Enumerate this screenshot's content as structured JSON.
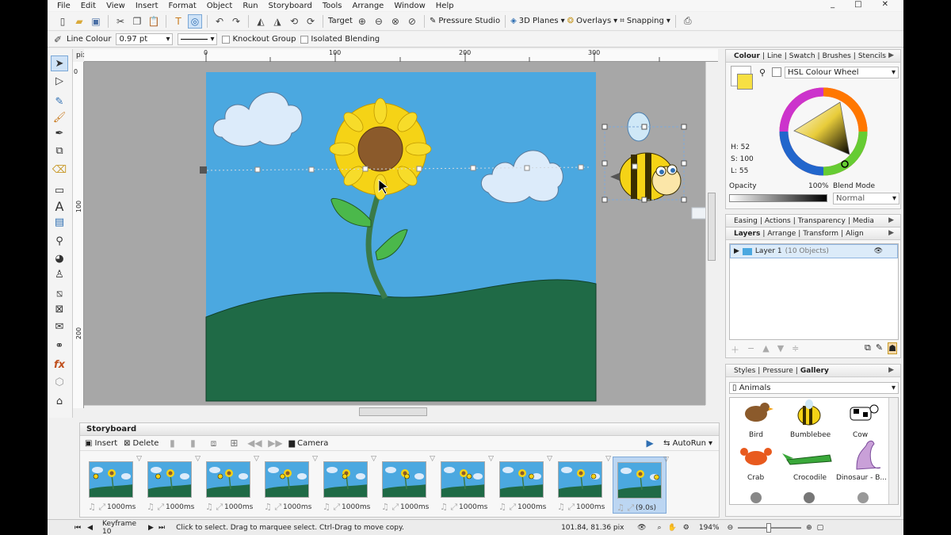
{
  "menu": [
    "File",
    "Edit",
    "View",
    "Insert",
    "Format",
    "Object",
    "Run",
    "Storyboard",
    "Tools",
    "Arrange",
    "Window",
    "Help"
  ],
  "window_controls": {
    "minimize": "_",
    "restore": "□",
    "close": "✕"
  },
  "toolbar": {
    "target": "Target",
    "pressure_studio": "Pressure Studio",
    "planes_3d": "3D Planes",
    "overlays": "Overlays",
    "snapping": "Snapping"
  },
  "context": {
    "line_colour_label": "Line Colour",
    "line_width": "0.97 pt",
    "knockout_group": "Knockout Group",
    "isolated_blending": "Isolated Blending"
  },
  "ruler": {
    "unit": "pix",
    "h_ticks": [
      "0",
      "100",
      "200",
      "300"
    ],
    "v_ticks": [
      "0",
      "100",
      "200"
    ]
  },
  "colour_panel": {
    "tabs": [
      "Colour",
      "Line",
      "Swatch",
      "Brushes",
      "Stencils"
    ],
    "model": "HSL Colour Wheel",
    "h": "H: 52",
    "s": "S: 100",
    "l": "L: 55",
    "opacity_label": "Opacity",
    "opacity_value": "100%",
    "blend_mode_label": "Blend Mode",
    "blend_mode": "Normal",
    "fill_color": "#f7e043"
  },
  "panel_tabs_2": [
    "Easing",
    "Actions",
    "Transparency",
    "Media"
  ],
  "layers_panel": {
    "tabs": [
      "Layers",
      "Arrange",
      "Transform",
      "Align"
    ],
    "layer_name": "Layer 1",
    "layer_count": "(10 Objects)"
  },
  "gallery_panel": {
    "tabs": [
      "Styles",
      "Pressure",
      "Gallery"
    ],
    "category": "Animals",
    "items": [
      "Bird",
      "Bumblebee",
      "Cow",
      "Crab",
      "Crocodile",
      "Dinosaur - B..."
    ]
  },
  "storyboard": {
    "title": "Storyboard",
    "insert": "Insert",
    "delete": "Delete",
    "camera": "Camera",
    "autorun": "AutoRun",
    "frames": [
      "1000ms",
      "1000ms",
      "1000ms",
      "1000ms",
      "1000ms",
      "1000ms",
      "1000ms",
      "1000ms",
      "1000ms",
      "(9.0s)"
    ]
  },
  "status": {
    "keyframe": "Keyframe 10",
    "hint": "Click to select. Drag to marquee select. Ctrl-Drag to move copy.",
    "coords": "101.84, 81.36 pix",
    "zoom": "194%"
  },
  "colors": {
    "sky": "#4ba8e0",
    "grass": "#1f6a46",
    "petal": "#f5d316",
    "seed": "#8b5a2b",
    "stem": "#3a7a4a",
    "leaf": "#4bb84b",
    "cloud": "#dcebfa",
    "selection": "#7fa9d8"
  }
}
